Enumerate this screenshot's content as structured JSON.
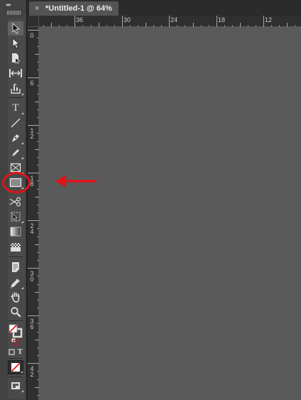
{
  "document_tab": {
    "title": "*Untitled-1 @ 64%",
    "close_symbol": "×"
  },
  "ruler": {
    "horizontal_labels": [
      "36",
      "30",
      "24",
      "18",
      "12"
    ],
    "vertical_labels": [
      "0",
      "6",
      "12",
      "18",
      "24",
      "30",
      "36",
      "42"
    ]
  },
  "tools_panel": {
    "collapse_symbol": "▸▸",
    "tools": [
      {
        "name": "selection-tool",
        "icon": "arrow-black-icon"
      },
      {
        "name": "direct-selection-tool",
        "icon": "arrow-white-icon"
      },
      {
        "name": "page-tool",
        "icon": "page-icon"
      },
      {
        "name": "gap-tool",
        "icon": "gap-icon"
      },
      {
        "name": "content-collector-tool",
        "icon": "content-collector-icon"
      },
      {
        "name": "type-tool",
        "icon": "type-icon",
        "glyph": "T"
      },
      {
        "name": "line-tool",
        "icon": "line-icon"
      },
      {
        "name": "pen-tool",
        "icon": "pen-icon"
      },
      {
        "name": "pencil-tool",
        "icon": "pencil-icon"
      },
      {
        "name": "rectangle-frame-tool",
        "icon": "rectangle-frame-icon"
      },
      {
        "name": "rectangle-tool",
        "icon": "rectangle-icon",
        "selected": true
      },
      {
        "name": "scissors-tool",
        "icon": "scissors-icon"
      },
      {
        "name": "free-transform-tool",
        "icon": "free-transform-icon"
      },
      {
        "name": "gradient-swatch-tool",
        "icon": "gradient-icon"
      },
      {
        "name": "gradient-feather-tool",
        "icon": "gradient-feather-icon"
      },
      {
        "name": "note-tool",
        "icon": "note-icon"
      },
      {
        "name": "eyedropper-tool",
        "icon": "eyedropper-icon"
      },
      {
        "name": "hand-tool",
        "icon": "hand-icon"
      },
      {
        "name": "zoom-tool",
        "icon": "zoom-icon"
      },
      {
        "name": "fill-stroke-swatches",
        "icon": "fill-stroke-icon"
      },
      {
        "name": "formatting-affects-container",
        "icon": "container-icon",
        "glyph": "T"
      },
      {
        "name": "apply-none",
        "icon": "apply-none-icon"
      },
      {
        "name": "screen-mode",
        "icon": "screen-mode-icon"
      }
    ]
  },
  "colors": {
    "panel": "#424242",
    "canvas": "#5a5a5a",
    "annotation": "#e0121a"
  }
}
